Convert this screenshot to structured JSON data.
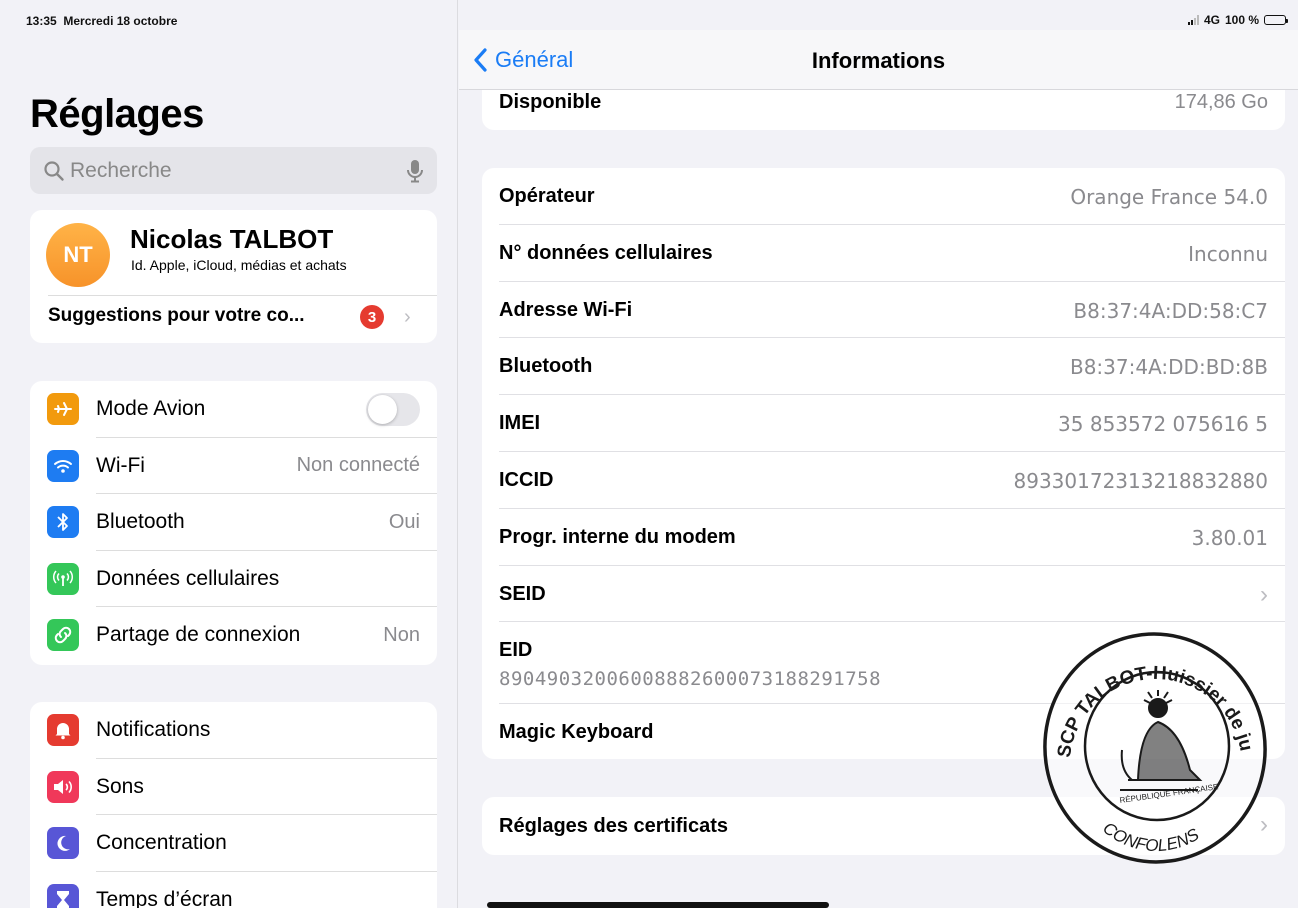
{
  "status": {
    "time": "13:35",
    "date": "Mercredi 18 octobre",
    "network": "4G",
    "battery": "100 %",
    "battery_level": 1.0
  },
  "sidebar": {
    "title": "Réglages",
    "search_placeholder": "Recherche",
    "profile": {
      "initials": "NT",
      "name": "Nicolas TALBOT",
      "subtitle": "Id. Apple, iCloud, médias et achats",
      "suggestions": "Suggestions pour votre co...",
      "badge": "3"
    },
    "connectivity": [
      {
        "label": "Mode Avion",
        "value": "",
        "icon": "airplane-icon",
        "color": "#f29a0d",
        "toggle_on": false
      },
      {
        "label": "Wi-Fi",
        "value": "Non connecté",
        "icon": "wifi-icon",
        "color": "#1e7cf2"
      },
      {
        "label": "Bluetooth",
        "value": "Oui",
        "icon": "bluetooth-icon",
        "color": "#1e7cf2"
      },
      {
        "label": "Données cellulaires",
        "value": "",
        "icon": "antenna-icon",
        "color": "#34c759"
      },
      {
        "label": "Partage de connexion",
        "value": "Non",
        "icon": "hotspot-icon",
        "color": "#34c759"
      }
    ],
    "notifications_group": [
      {
        "label": "Notifications",
        "icon": "bell-icon",
        "color": "#e53b30"
      },
      {
        "label": "Sons",
        "icon": "speaker-icon",
        "color": "#f0385a"
      },
      {
        "label": "Concentration",
        "icon": "moon-icon",
        "color": "#5856d6"
      },
      {
        "label": "Temps d’écran",
        "icon": "hourglass-icon",
        "color": "#5856d6"
      }
    ]
  },
  "main": {
    "back_label": "Général",
    "title": "Informations",
    "available": {
      "label": "Disponible",
      "value": "174,86 Go"
    },
    "rows": [
      {
        "label": "Opérateur",
        "value": "Orange France 54.0"
      },
      {
        "label": "N° données cellulaires",
        "value": "Inconnu"
      },
      {
        "label": "Adresse Wi-Fi",
        "value": "B8:37:4A:DD:58:C7"
      },
      {
        "label": "Bluetooth",
        "value": "B8:37:4A:DD:BD:8B"
      },
      {
        "label": "IMEI",
        "value": "35 853572 075616 5"
      },
      {
        "label": "ICCID",
        "value": "89330172313218832880"
      },
      {
        "label": "Progr. interne du modem",
        "value": "3.80.01"
      },
      {
        "label": "SEID",
        "value": ""
      }
    ],
    "eid": {
      "label": "EID",
      "value": "89049032006008882600073188291758"
    },
    "magic_keyboard": {
      "label": "Magic Keyboard"
    },
    "certificates": {
      "label": "Réglages des certificats"
    }
  },
  "stamp": {
    "top_text": "SCP TALBOT-Huissier de justice associé",
    "bottom_text": "CONFOLENS",
    "center_text": "RÉPUBLIQUE FRANÇAISE",
    "color": "#1a1a1a"
  }
}
